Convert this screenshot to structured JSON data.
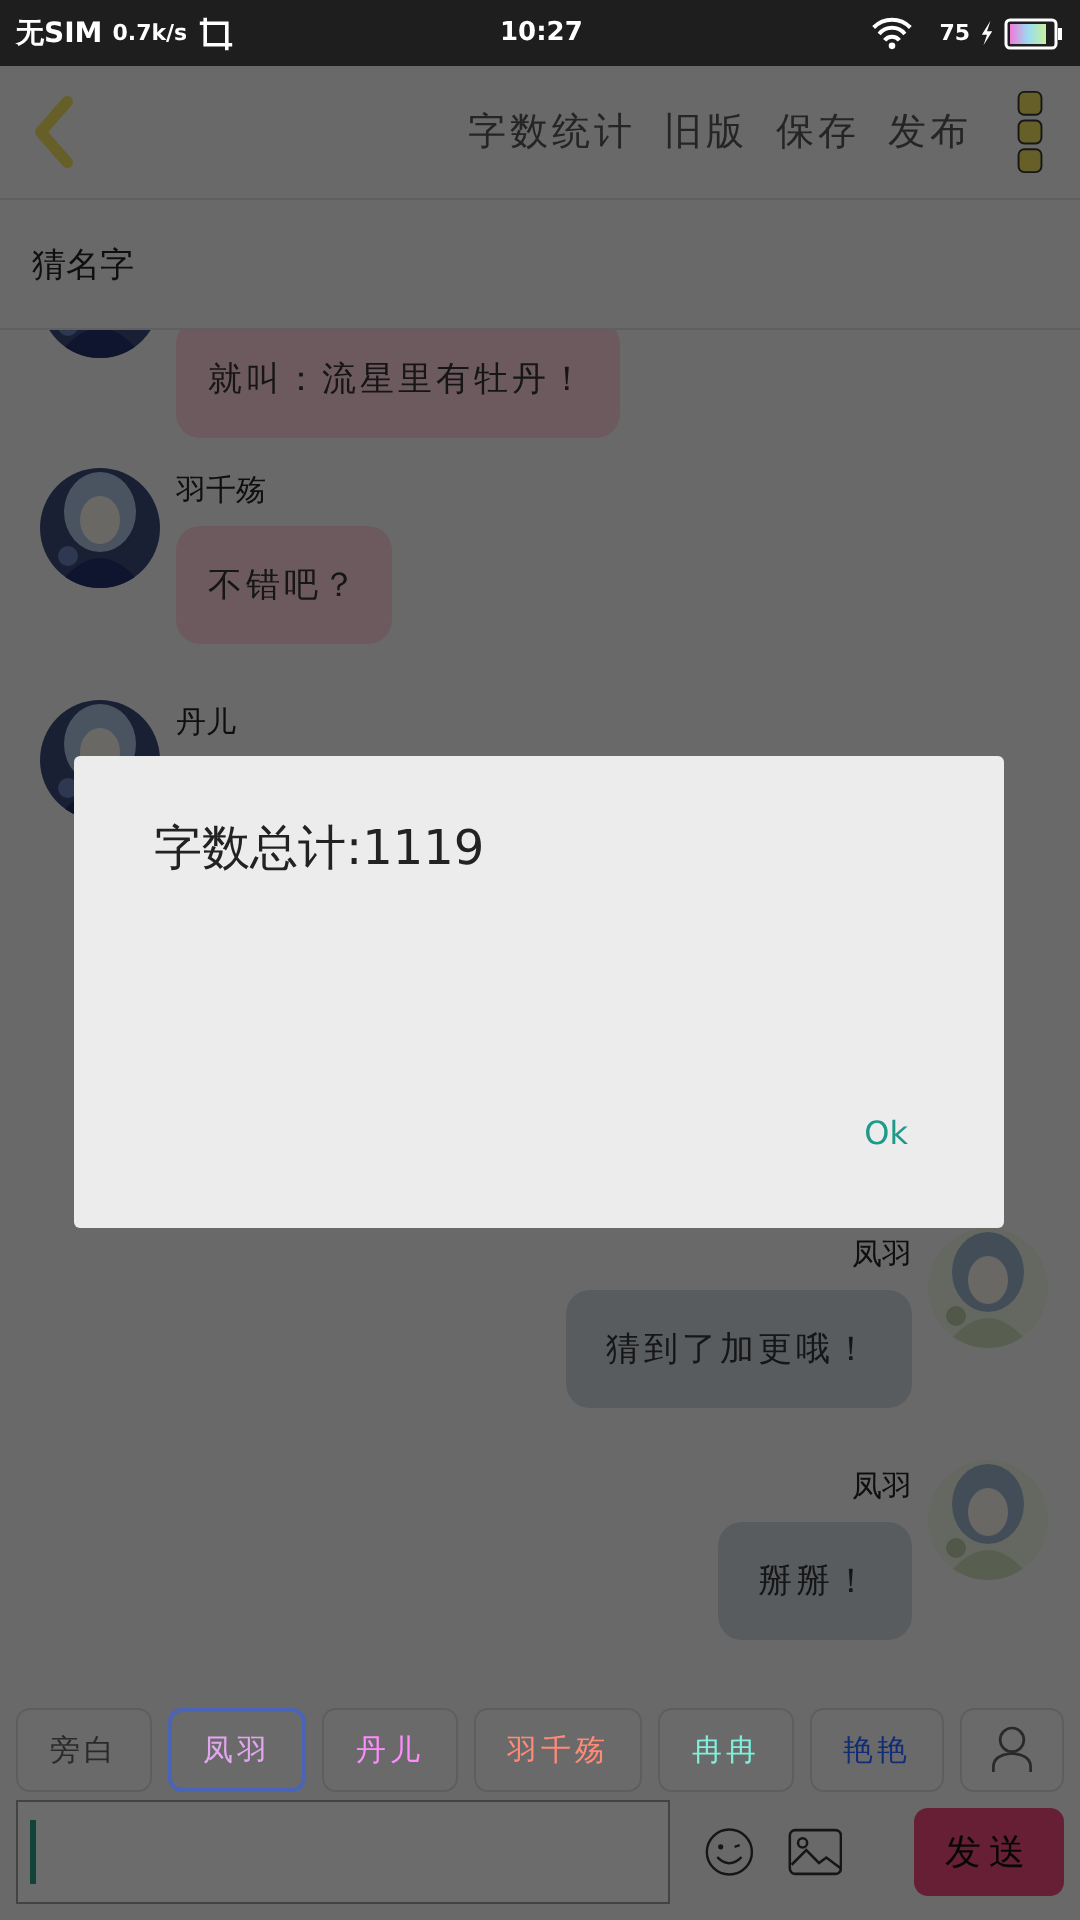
{
  "status_bar": {
    "carrier": "无SIM",
    "speed": "0.7k/s",
    "time": "10:27",
    "battery": "75"
  },
  "toolbar": {
    "actions": [
      "字数统计",
      "旧版",
      "保存",
      "发布"
    ]
  },
  "title": "猜名字",
  "messages": [
    {
      "outgoing": false,
      "text": "就叫：流星里有牡丹！"
    },
    {
      "outgoing": false,
      "name": "羽千殇",
      "text": "不错吧？"
    },
    {
      "outgoing": false,
      "name": "丹儿"
    },
    {
      "outgoing": true,
      "name": "凤羽",
      "text": "猜到了加更哦！"
    },
    {
      "outgoing": true,
      "name": "凤羽",
      "text": "掰掰！"
    }
  ],
  "roles": [
    {
      "label": "旁白",
      "color": "#2a2a2a",
      "selected": false
    },
    {
      "label": "凤羽",
      "color": "#e2a6f0",
      "selected": true
    },
    {
      "label": "丹儿",
      "color": "#ff8cff",
      "selected": false
    },
    {
      "label": "羽千殇",
      "color": "#ff8a78",
      "selected": false
    },
    {
      "label": "冉冉",
      "color": "#7ef0da",
      "selected": false
    },
    {
      "label": "艳艳",
      "color": "#122c76",
      "selected": false
    }
  ],
  "composer": {
    "send": "发送"
  },
  "dialog": {
    "message": "字数总计:1119",
    "button": "Ok"
  }
}
